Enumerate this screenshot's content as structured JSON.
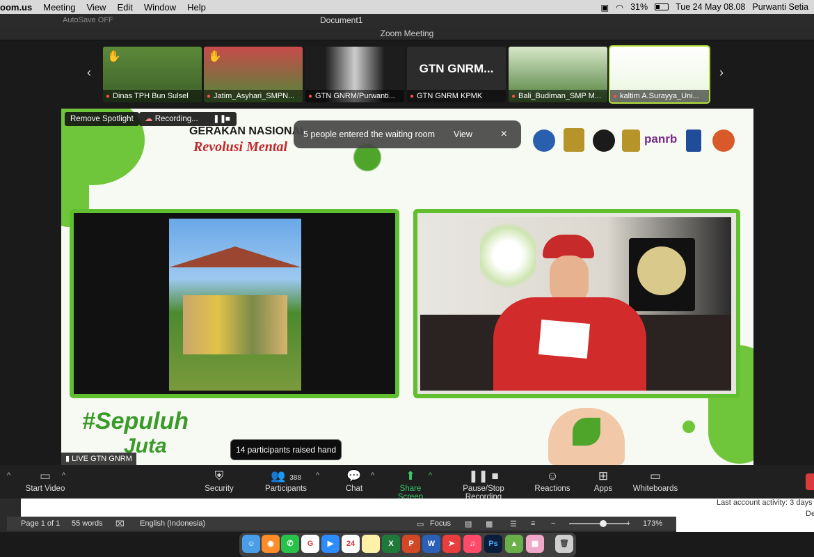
{
  "menubar": {
    "app": "oom.us",
    "items": [
      "Meeting",
      "View",
      "Edit",
      "Window",
      "Help"
    ],
    "battery": "31%",
    "datetime": "Tue 24 May  08.08",
    "user": "Purwanti Setia"
  },
  "word": {
    "autosave": "AutoSave",
    "autosave_state": "OFF",
    "doc_title": "Document1",
    "status": {
      "page": "Page 1 of 1",
      "words": "55 words",
      "language": "English (Indonesia)",
      "focus": "Focus",
      "zoom": "173%"
    },
    "side_text": "Last account activity: 3 days",
    "side_text2": "De"
  },
  "zoom": {
    "window_title": "Zoom Meeting",
    "gallery": [
      {
        "name": "Dinas TPH Bun Sulsel",
        "hand": true,
        "active": false
      },
      {
        "name": "Jatim_Asyhari_SMPN...",
        "hand": true,
        "active": false
      },
      {
        "name": "GTN GNRM/Purwanti...",
        "hand": false,
        "active": false
      },
      {
        "name": "GTN GNRM KPMK",
        "hand": false,
        "active": false,
        "big": "GTN GNRM..."
      },
      {
        "name": "Bali_Budiman_SMP M...",
        "hand": false,
        "active": false
      },
      {
        "name": "kaltim A.Surayya_Uni...",
        "hand": false,
        "active": true
      }
    ],
    "remove_spotlight": "Remove Spotlight",
    "recording": "Recording...",
    "toast": {
      "message": "5 people entered the waiting room",
      "view": "View"
    },
    "live_badge": "LIVE GTN GNRM",
    "raised_hand_tip": "14 participants raised hand",
    "toolbar": {
      "start_video": "Start Video",
      "security": "Security",
      "participants": "Participants",
      "participants_count": "388",
      "chat": "Chat",
      "share_screen": "Share Screen",
      "pause_stop_recording": "Pause/Stop Recording",
      "reactions": "Reactions",
      "apps": "Apps",
      "whiteboards": "Whiteboards"
    }
  },
  "slide": {
    "heading_line1": "GERAKAN NASIONAL",
    "heading_line2": "Revolusi Mental",
    "logo_text": "panrb",
    "hashtag_line1": "#Sepuluh",
    "hashtag_line2": "Juta"
  },
  "dock": {
    "calendar_day": "24"
  },
  "colors": {
    "accent_green": "#5fbf2f",
    "share_green": "#39c96b",
    "end_red": "#d93b3b"
  }
}
